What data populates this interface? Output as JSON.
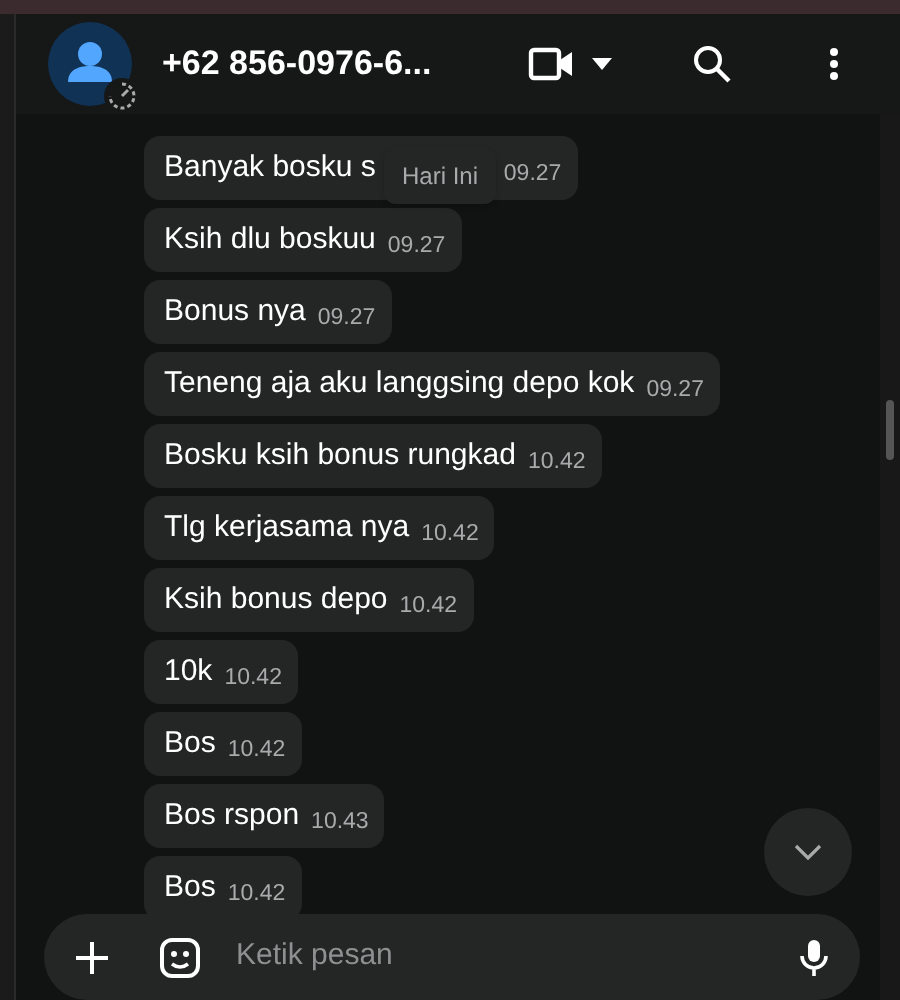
{
  "header": {
    "title": "+62 856-0976-6..."
  },
  "date_chip": "Hari Ini",
  "messages": [
    {
      "text": "Banyak bosku s",
      "time": "09.27"
    },
    {
      "text": "Ksih dlu boskuu",
      "time": "09.27"
    },
    {
      "text": "Bonus nya",
      "time": "09.27"
    },
    {
      "text": "Teneng aja aku langgsing depo kok",
      "time": "09.27"
    },
    {
      "text": "Bosku ksih bonus rungkad",
      "time": "10.42"
    },
    {
      "text": "Tlg kerjasama nya",
      "time": "10.42"
    },
    {
      "text": "Ksih bonus depo",
      "time": "10.42"
    },
    {
      "text": "10k",
      "time": "10.42"
    },
    {
      "text": "Bos",
      "time": "10.42"
    },
    {
      "text": "Bos rspon",
      "time": "10.43"
    },
    {
      "text": "Bos",
      "time": "10.42"
    }
  ],
  "composer": {
    "placeholder": "Ketik pesan"
  }
}
